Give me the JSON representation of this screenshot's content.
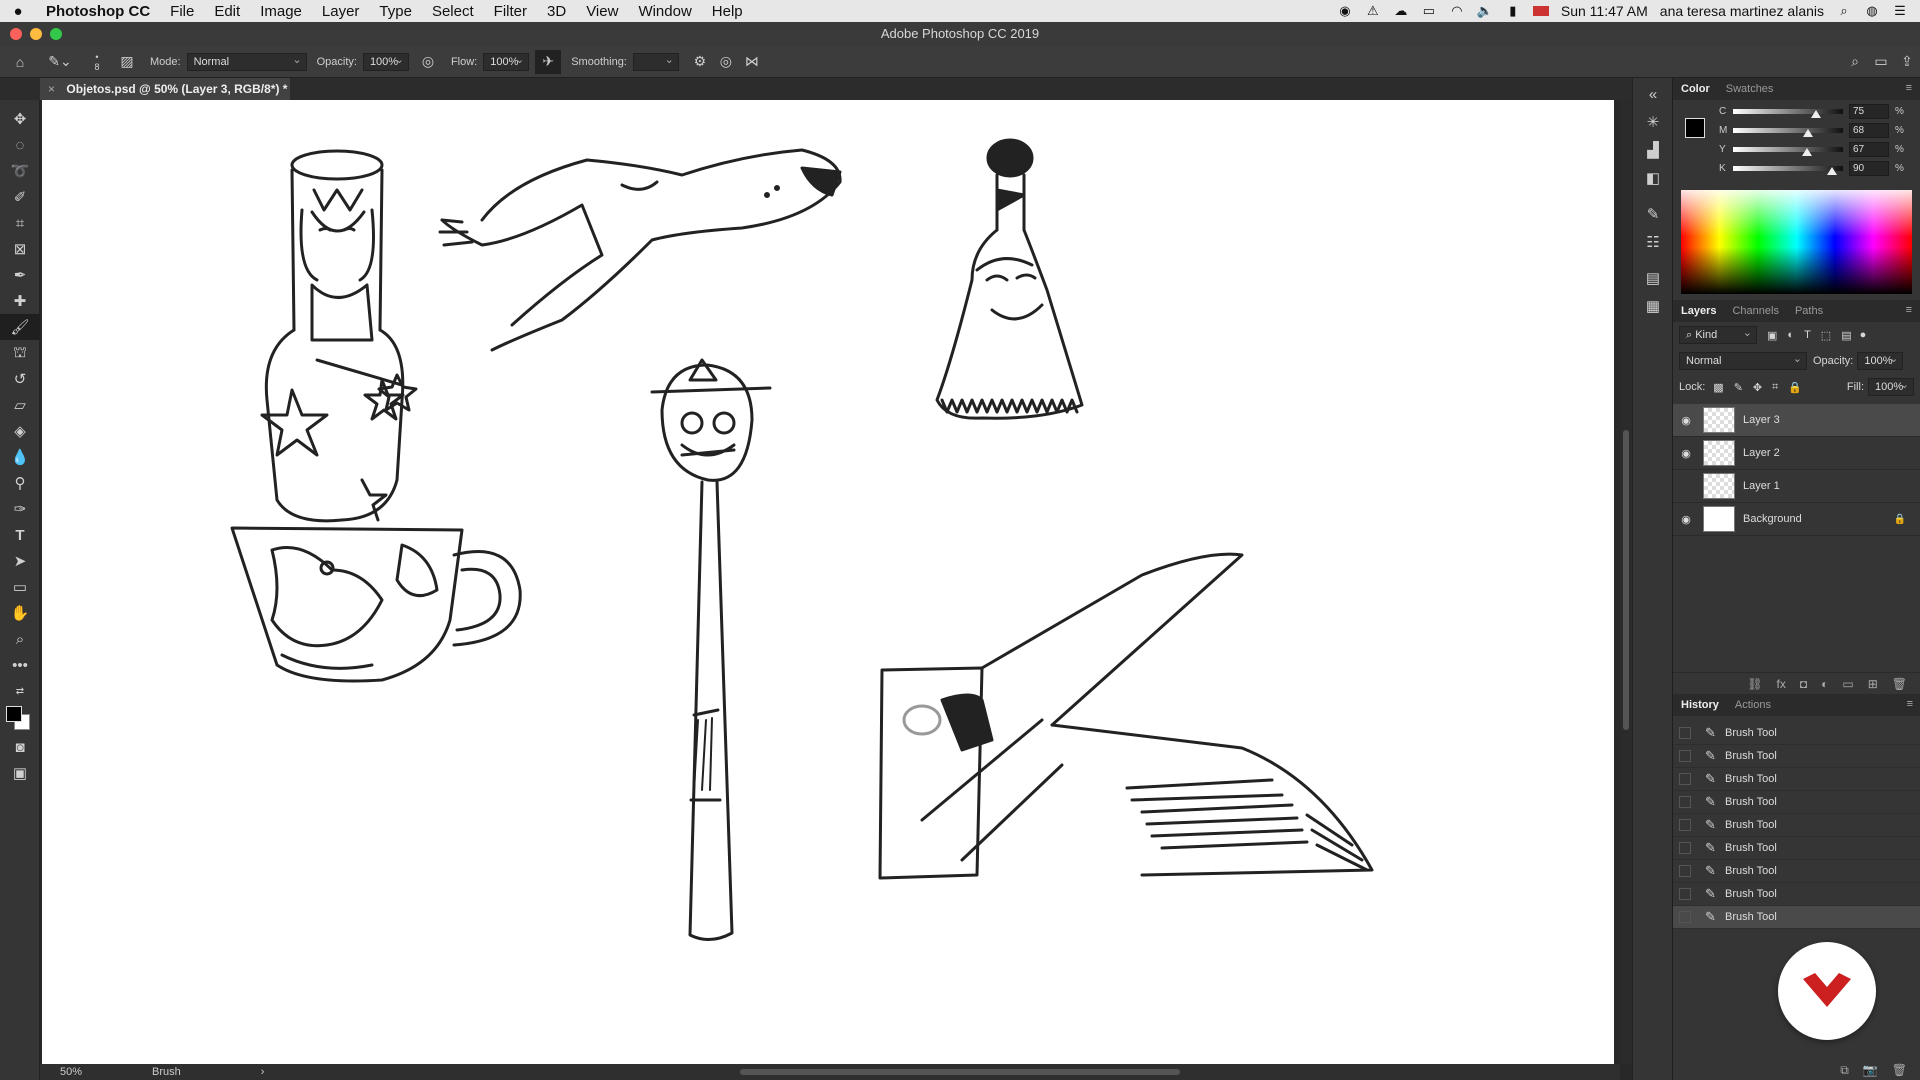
{
  "menubar": {
    "app_name": "Photoshop CC",
    "items": [
      "File",
      "Edit",
      "Image",
      "Layer",
      "Type",
      "Select",
      "Filter",
      "3D",
      "View",
      "Window",
      "Help"
    ],
    "clock": "Sun 11:47 AM",
    "user": "ana teresa martinez alanis"
  },
  "window": {
    "title": "Adobe Photoshop CC 2019"
  },
  "options": {
    "brush_size": "8",
    "mode_label": "Mode:",
    "mode_value": "Normal",
    "opacity_label": "Opacity:",
    "opacity_value": "100%",
    "flow_label": "Flow:",
    "flow_value": "100%",
    "smoothing_label": "Smoothing:",
    "smoothing_value": ""
  },
  "document": {
    "tab_close": "×",
    "tab_title": "Objetos.psd @ 50% (Layer 3, RGB/8*) *"
  },
  "status": {
    "zoom": "50%",
    "info": "Brush",
    "arrow": "›"
  },
  "color_panel": {
    "tabs": [
      "Color",
      "Swatches"
    ],
    "channels": [
      {
        "name": "C",
        "value": "75",
        "pct": "%",
        "fraction": 0.75
      },
      {
        "name": "M",
        "value": "68",
        "pct": "%",
        "fraction": 0.68
      },
      {
        "name": "Y",
        "value": "67",
        "pct": "%",
        "fraction": 0.67
      },
      {
        "name": "K",
        "value": "90",
        "pct": "%",
        "fraction": 0.9
      }
    ]
  },
  "layers_panel": {
    "tabs": [
      "Layers",
      "Channels",
      "Paths"
    ],
    "kind": "Kind",
    "blend": "Normal",
    "opacity_label": "Opacity:",
    "opacity_value": "100%",
    "lock_label": "Lock:",
    "fill_label": "Fill:",
    "fill_value": "100%",
    "layers": [
      {
        "name": "Layer 3",
        "visible": true,
        "selected": true
      },
      {
        "name": "Layer 2",
        "visible": true,
        "selected": false
      },
      {
        "name": "Layer 1",
        "visible": false,
        "selected": false
      },
      {
        "name": "Background",
        "visible": true,
        "selected": false,
        "locked": true
      }
    ]
  },
  "history_panel": {
    "tabs": [
      "History",
      "Actions"
    ],
    "items": [
      "Brush Tool",
      "Brush Tool",
      "Brush Tool",
      "Brush Tool",
      "Brush Tool",
      "Brush Tool",
      "Brush Tool",
      "Brush Tool",
      "Brush Tool"
    ]
  },
  "colors": {
    "accent": "#cc1f1f",
    "canvas": "#ffffff",
    "panel": "#353535"
  }
}
